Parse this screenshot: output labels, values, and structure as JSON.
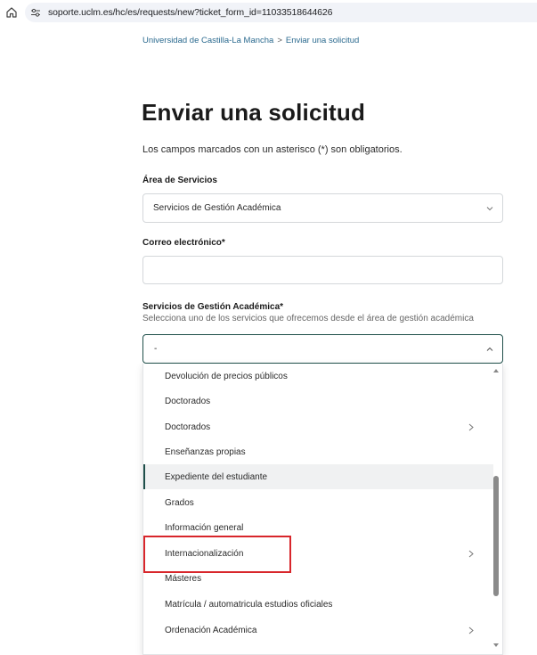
{
  "browser": {
    "url": "soporte.uclm.es/hc/es/requests/new?ticket_form_id=11033518644626"
  },
  "breadcrumb": {
    "root": "Universidad de Castilla-La Mancha",
    "separator": ">",
    "current": "Enviar una solicitud"
  },
  "page": {
    "title": "Enviar una solicitud",
    "required_note": "Los campos marcados con un asterisco (*) son obligatorios."
  },
  "form": {
    "area": {
      "label": "Área de Servicios",
      "value": "Servicios de Gestión Académica"
    },
    "email": {
      "label": "Correo electrónico*",
      "value": ""
    },
    "services": {
      "label": "Servicios de Gestión Académica*",
      "hint": "Selecciona uno de los servicios que ofrecemos desde el área de gestión académica",
      "value": "-",
      "options": [
        {
          "label": "Devolución de precios públicos",
          "has_submenu": false,
          "active": false
        },
        {
          "label": "Doctorados",
          "has_submenu": false,
          "active": false
        },
        {
          "label": "Doctorados",
          "has_submenu": true,
          "active": false
        },
        {
          "label": "Enseñanzas propias",
          "has_submenu": false,
          "active": false
        },
        {
          "label": "Expediente del estudiante",
          "has_submenu": false,
          "active": true
        },
        {
          "label": "Grados",
          "has_submenu": false,
          "active": false
        },
        {
          "label": "Información general",
          "has_submenu": false,
          "active": false
        },
        {
          "label": "Internacionalización",
          "has_submenu": true,
          "active": false
        },
        {
          "label": "Másteres",
          "has_submenu": false,
          "active": false
        },
        {
          "label": "Matrícula / automatricula estudios oficiales",
          "has_submenu": false,
          "active": false
        },
        {
          "label": "Ordenación Académica",
          "has_submenu": true,
          "active": false
        }
      ]
    }
  },
  "colors": {
    "accent": "#1f4f4a",
    "link": "#2b6a8f",
    "highlight": "#d8262b"
  }
}
